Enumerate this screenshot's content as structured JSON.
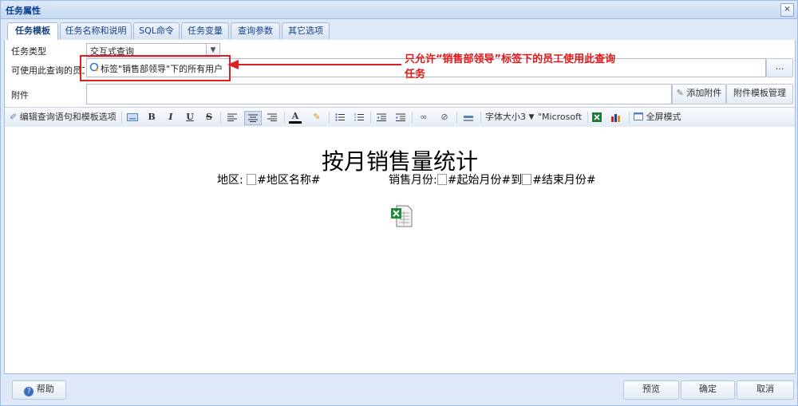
{
  "window": {
    "title": "任务属性",
    "close_symbol": "×"
  },
  "tabs": [
    {
      "label": "任务模板",
      "active": true
    },
    {
      "label": "任务名称和说明"
    },
    {
      "label": "SQL命令"
    },
    {
      "label": "任务变量"
    },
    {
      "label": "查询参数"
    },
    {
      "label": "其它选项"
    }
  ],
  "form": {
    "task_type_label": "任务类型",
    "task_type_value": "交互式查询",
    "allowed_users_label": "可使用此查询的员工",
    "allowed_users_value": "标签\"销售部领导\"下的所有用户",
    "ellipsis_button": "...",
    "attachment_label": "附件",
    "add_attachment_button": "添加附件",
    "manage_template_button": "附件模板管理"
  },
  "toolbar": {
    "edit_query": "编辑查询语句和模板选项",
    "bold": "B",
    "italic": "I",
    "underline": "U",
    "strike": "S",
    "font_color": "A",
    "font_size": "字体大小3",
    "font_name": "\"Microsoft Ya",
    "fullscreen": "全屏模式"
  },
  "document": {
    "title": "按月销售量统计",
    "region_label": "地区:",
    "region_var": "#地区名称#",
    "month_label": "销售月份:",
    "start_var": "#起始月份#",
    "to_word": "到",
    "end_var": "#结束月份#"
  },
  "footer": {
    "help_button": "帮助",
    "preview_button": "预览",
    "ok_button": "确定",
    "cancel_button": "取消"
  },
  "annotation": {
    "line1": "只允许“销售部领导”标签下的员工使用此查询",
    "line2": "任务",
    "color": "#e01818"
  }
}
